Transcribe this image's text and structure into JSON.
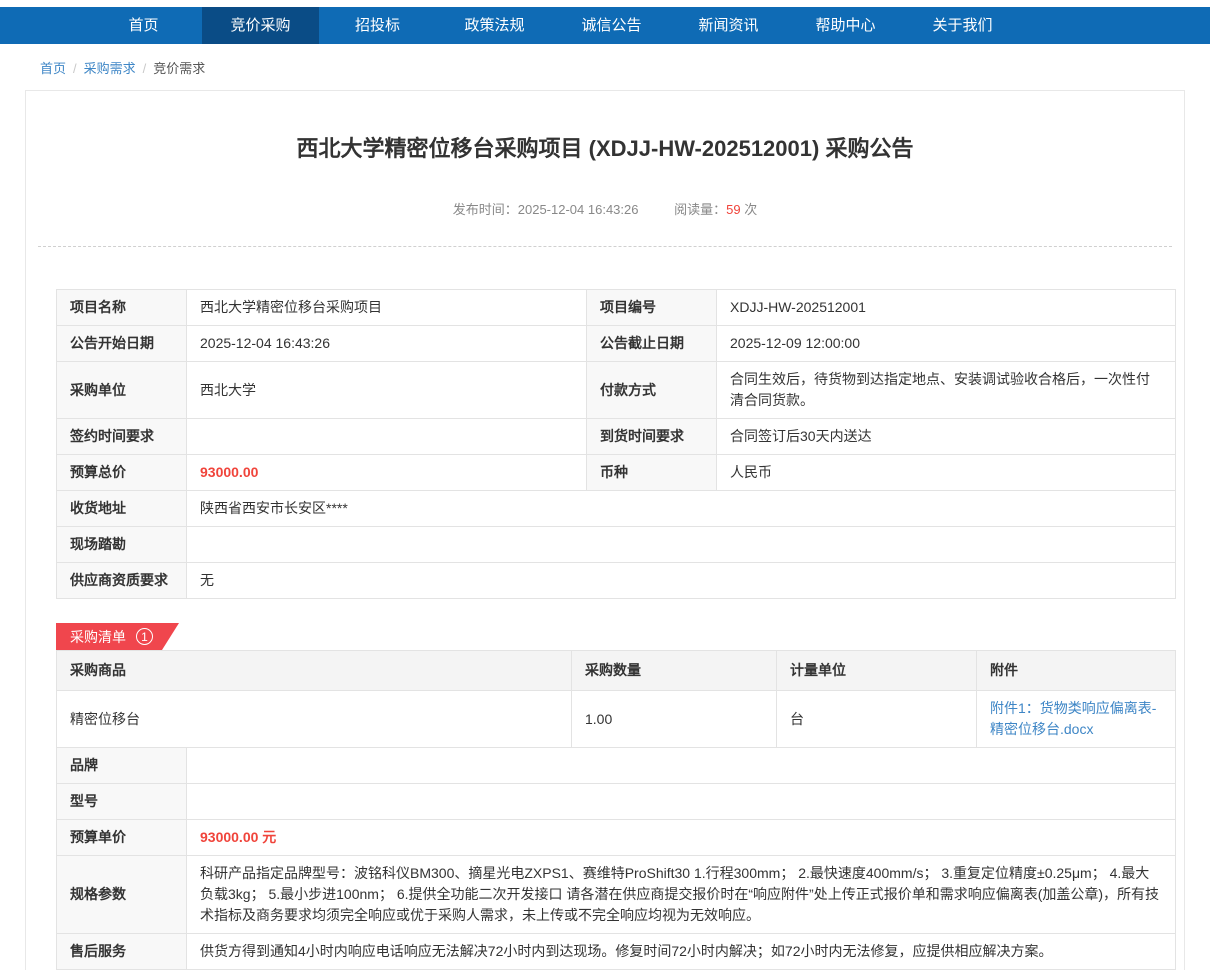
{
  "nav": {
    "items": [
      {
        "label": "首页",
        "active": false
      },
      {
        "label": "竞价采购",
        "active": true
      },
      {
        "label": "招投标",
        "active": false
      },
      {
        "label": "政策法规",
        "active": false
      },
      {
        "label": "诚信公告",
        "active": false
      },
      {
        "label": "新闻资讯",
        "active": false
      },
      {
        "label": "帮助中心",
        "active": false
      },
      {
        "label": "关于我们",
        "active": false
      }
    ]
  },
  "breadcrumb": {
    "items": [
      "首页",
      "采购需求",
      "竞价需求"
    ],
    "separator": "/"
  },
  "page": {
    "title": "西北大学精密位移台采购项目 (XDJJ-HW-202512001) 采购公告",
    "publish_time_label": "发布时间：",
    "publish_time": "2025-12-04 16:43:26",
    "views_label": "阅读量：",
    "views": "59",
    "views_unit": "次"
  },
  "info_table": {
    "rows4": [
      {
        "l1": "项目名称",
        "v1": "西北大学精密位移台采购项目",
        "l2": "项目编号",
        "v2": "XDJJ-HW-202512001"
      },
      {
        "l1": "公告开始日期",
        "v1": "2025-12-04 16:43:26",
        "l2": "公告截止日期",
        "v2": "2025-12-09 12:00:00"
      },
      {
        "l1": "采购单位",
        "v1": "西北大学",
        "l2": "付款方式",
        "v2": "合同生效后，待货物到达指定地点、安装调试验收合格后，一次性付清合同货款。"
      },
      {
        "l1": "签约时间要求",
        "v1": "",
        "l2": "到货时间要求",
        "v2": "合同签订后30天内送达"
      },
      {
        "l1": "预算总价",
        "v1": "93000.00",
        "l2": "币种",
        "v2": "人民币"
      }
    ],
    "rows_full": [
      {
        "label": "收货地址",
        "value": "陕西省西安市长安区****"
      },
      {
        "label": "现场踏勘",
        "value": ""
      },
      {
        "label": "供应商资质要求",
        "value": "无"
      }
    ]
  },
  "list_section": {
    "tab_label": "采购清单",
    "tab_count": "1",
    "headers": [
      "采购商品",
      "采购数量",
      "计量单位",
      "附件"
    ],
    "row": {
      "product": "精密位移台",
      "quantity": "1.00",
      "unit": "台",
      "attachment": "附件1：货物类响应偏离表-精密位移台.docx"
    },
    "details": [
      {
        "label": "品牌",
        "value": ""
      },
      {
        "label": "型号",
        "value": ""
      },
      {
        "label": "预算单价",
        "value": "93000.00 元"
      },
      {
        "label": "规格参数",
        "value": "科研产品指定品牌型号：波铭科仪BM300、摘星光电ZXPS1、赛维特ProShift30 1.行程300mm； 2.最快速度400mm/s； 3.重复定位精度±0.25μm； 4.最大负载3kg； 5.最小步进100nm； 6.提供全功能二次开发接口 请各潜在供应商提交报价时在“响应附件”处上传正式报价单和需求响应偏离表(加盖公章)，所有技术指标及商务要求均须完全响应或优于采购人需求，未上传或不完全响应均视为无效响应。"
      },
      {
        "label": "售后服务",
        "value": "供货方得到通知4小时内响应电话响应无法解决72小时内到达现场。修复时间72小时内解决；如72小时内无法修复，应提供相应解决方案。"
      }
    ]
  },
  "colors": {
    "nav_bg": "#0f6bb5",
    "nav_active_bg": "#0a4c86",
    "tag_red": "#f0464d",
    "price_red": "#f0443b",
    "link_blue": "#3e86c6"
  }
}
